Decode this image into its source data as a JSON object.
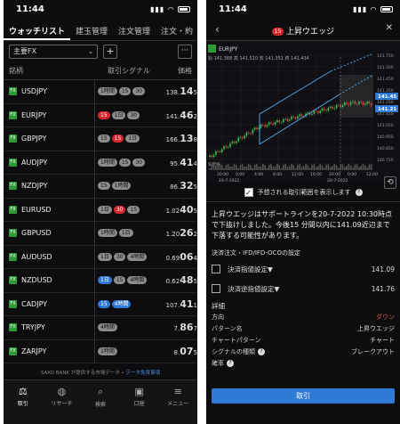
{
  "left": {
    "time": "11:44",
    "tabs": [
      "ウォッチリスト",
      "建玉管理",
      "注文管理",
      "注文・約"
    ],
    "list_select": "主要FX",
    "add_label": "+",
    "more_label": "···",
    "columns": {
      "symbol": "銘柄",
      "signal": "取引シグナル",
      "price": "価格"
    },
    "rows": [
      {
        "symbol": "USDJPY",
        "signals": [
          {
            "t": "1時間",
            "c": "gray"
          },
          {
            "t": "15",
            "c": "gray"
          },
          {
            "t": "30",
            "c": "gray"
          }
        ],
        "price_small": "138.",
        "price_big": "14",
        "price_tail": "5"
      },
      {
        "symbol": "EURJPY",
        "signals": [
          {
            "t": "15",
            "c": "red"
          },
          {
            "t": "1日",
            "c": "gray"
          },
          {
            "t": "30",
            "c": "gray"
          }
        ],
        "price_small": "141.",
        "price_big": "46",
        "price_tail": "2"
      },
      {
        "symbol": "GBPJPY",
        "signals": [
          {
            "t": "15",
            "c": "gray"
          },
          {
            "t": "15",
            "c": "red"
          },
          {
            "t": "1日",
            "c": "gray"
          }
        ],
        "price_small": "166.",
        "price_big": "13",
        "price_tail": "8"
      },
      {
        "symbol": "AUDJPY",
        "signals": [
          {
            "t": "1時間",
            "c": "gray"
          },
          {
            "t": "15",
            "c": "gray"
          },
          {
            "t": "30",
            "c": "gray"
          }
        ],
        "price_small": "95.",
        "price_big": "41",
        "price_tail": "4"
      },
      {
        "symbol": "NZDJPY",
        "signals": [
          {
            "t": "15",
            "c": "gray"
          },
          {
            "t": "1時間",
            "c": "gray"
          }
        ],
        "price_small": "86.",
        "price_big": "32",
        "price_tail": "5"
      },
      {
        "symbol": "EURUSD",
        "signals": [
          {
            "t": "1日",
            "c": "gray"
          },
          {
            "t": "30",
            "c": "red"
          },
          {
            "t": "15",
            "c": "gray"
          }
        ],
        "price_small": "1.02",
        "price_big": "40",
        "price_tail": "5"
      },
      {
        "symbol": "GBPUSD",
        "signals": [
          {
            "t": "1時間",
            "c": "gray"
          },
          {
            "t": "1日",
            "c": "gray"
          }
        ],
        "price_small": "1.20",
        "price_big": "26",
        "price_tail": "2"
      },
      {
        "symbol": "AUDUSD",
        "signals": [
          {
            "t": "1日",
            "c": "gray"
          },
          {
            "t": "30",
            "c": "gray"
          },
          {
            "t": "4時間",
            "c": "gray"
          }
        ],
        "price_small": "0.69",
        "price_big": "06",
        "price_tail": "4"
      },
      {
        "symbol": "NZDUSD",
        "signals": [
          {
            "t": "1日",
            "c": "blue"
          },
          {
            "t": "15",
            "c": "gray"
          },
          {
            "t": "4時間",
            "c": "gray"
          }
        ],
        "price_small": "0.62",
        "price_big": "48",
        "price_tail": "5"
      },
      {
        "symbol": "CADJPY",
        "signals": [
          {
            "t": "15",
            "c": "blue"
          },
          {
            "t": "4時間",
            "c": "blue"
          }
        ],
        "price_small": "107.",
        "price_big": "41",
        "price_tail": "1"
      },
      {
        "symbol": "TRYJPY",
        "signals": [
          {
            "t": "4時間",
            "c": "gray"
          }
        ],
        "price_small": "7.",
        "price_big": "86",
        "price_tail": "7"
      },
      {
        "symbol": "ZARJPY",
        "signals": [
          {
            "t": "1時間",
            "c": "gray"
          }
        ],
        "price_small": "8.",
        "price_big": "07",
        "price_tail": "5"
      }
    ],
    "footnote_prefix": "SAXO BANK が提供する市場データ • ",
    "footnote_link": "データ免責事項",
    "nav": [
      {
        "label": "取引",
        "icon": "⚖",
        "name": "trade"
      },
      {
        "label": "リサーチ",
        "icon": "◍",
        "name": "research"
      },
      {
        "label": "検索",
        "icon": "⌕",
        "name": "search"
      },
      {
        "label": "口座",
        "icon": "▣",
        "name": "account"
      },
      {
        "label": "メニュー",
        "icon": "≡",
        "name": "menu"
      }
    ]
  },
  "right": {
    "time": "11:44",
    "badge": "15",
    "title": "上昇ウエッジ",
    "close": "✕",
    "back": "‹",
    "checkbox_label": "予想される取引範囲を表示します",
    "description": "上昇ウエッジはサポートラインを20-7-2022 10:30時点で下抜けしました。今後15 分間以内に141.09近辺まで下落する可能性があります。",
    "order_line": "決済注文・IFD/IFD-OCOの設定",
    "limit_label": "決済指値設定▼",
    "limit_value": "141.09",
    "stop_label": "決済逆指値設定▼",
    "stop_value": "141.76",
    "detail_heading": "詳細",
    "details": [
      {
        "k": "方向",
        "v": "ダウン",
        "red": true
      },
      {
        "k": "パターン名",
        "v": "上昇ウエッジ"
      },
      {
        "k": "チャートパターン",
        "v": "チャート"
      },
      {
        "k": "シグナルの種類",
        "v": "ブレークアウト",
        "q": true
      },
      {
        "k": "確率",
        "v": "",
        "q": true
      }
    ],
    "trade_button": "取引",
    "chart": {
      "symbol": "EURJPY",
      "ohlc_line": "始 141.368  高 141.510  安 141.351  終 141.434",
      "y_ticks": [
        "141.750",
        "141.500",
        "141.450",
        "141.350",
        "141.250",
        "141.150",
        "141.050",
        "140.950",
        "140.850",
        "140.750"
      ],
      "price_tag1": "141.45",
      "price_tag2": "141.21",
      "x_ticks": [
        "20:00",
        "0:00",
        "4:00",
        "8:00",
        "12:00",
        "16:00",
        "20:00",
        "0:00",
        "12:00"
      ],
      "x_dates": [
        "19-7-2022",
        "20-7-2022"
      ],
      "volume_label": "気配値"
    }
  }
}
